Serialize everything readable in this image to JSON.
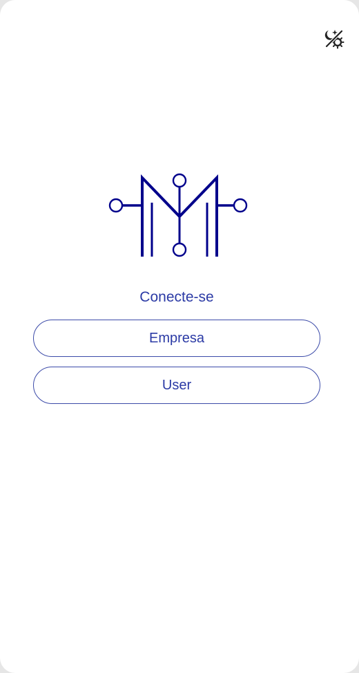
{
  "header": {
    "theme_toggle_icon": "theme-toggle-icon"
  },
  "logo": {
    "icon": "m-circuit-logo",
    "color": "#00008b"
  },
  "login": {
    "title": "Conecte-se",
    "options": [
      {
        "label": "Empresa"
      },
      {
        "label": "User"
      }
    ]
  },
  "colors": {
    "accent": "#2b3aa5",
    "background": "#ffffff"
  }
}
